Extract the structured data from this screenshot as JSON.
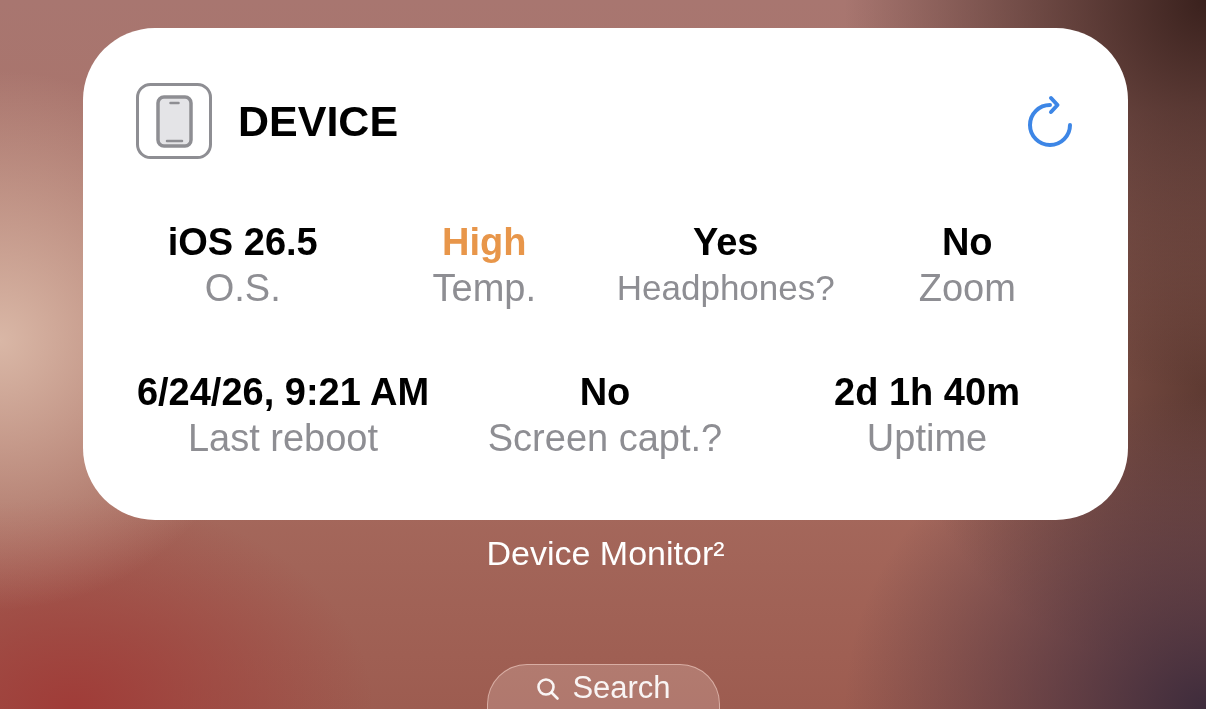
{
  "widget": {
    "title": "DEVICE",
    "rows": [
      {
        "items": [
          {
            "value": "iOS 26.5",
            "label": "O.S.",
            "color": "#000000"
          },
          {
            "value": "High",
            "label": "Temp.",
            "color": "#e8964a"
          },
          {
            "value": "Yes",
            "label": "Headphones?",
            "color": "#000000"
          },
          {
            "value": "No",
            "label": "Zoom",
            "color": "#000000"
          }
        ]
      },
      {
        "items": [
          {
            "value": "6/24/26, 9:21 AM",
            "label": "Last reboot",
            "color": "#000000"
          },
          {
            "value": "No",
            "label": "Screen capt.?",
            "color": "#000000"
          },
          {
            "value": "2d 1h 40m",
            "label": "Uptime",
            "color": "#000000"
          }
        ]
      }
    ]
  },
  "caption": "Device Monitor²",
  "search_button": {
    "label": "Search"
  }
}
